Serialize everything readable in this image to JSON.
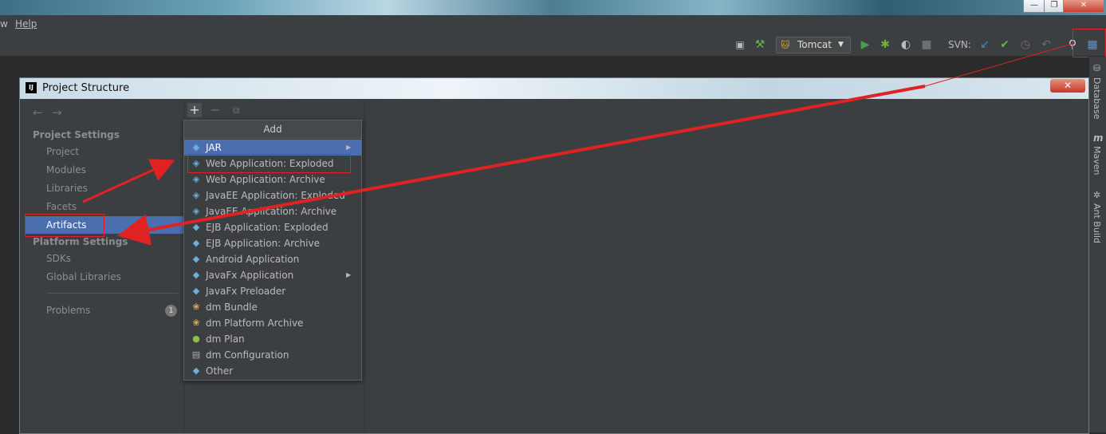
{
  "menubar": {
    "partial_item": "w",
    "help": "Help"
  },
  "toolbar": {
    "run_config": "Tomcat",
    "svn_label": "SVN:"
  },
  "right_strip": {
    "database": "Database",
    "maven": "Maven",
    "ant_build": "Ant Build"
  },
  "dialog": {
    "title": "Project Structure",
    "logo_text": "IJ",
    "close": "✕",
    "project_settings_header": "Project Settings",
    "project_items": [
      "Project",
      "Modules",
      "Libraries",
      "Facets",
      "Artifacts"
    ],
    "selected_item": "Artifacts",
    "platform_settings_header": "Platform Settings",
    "platform_items": [
      "SDKs",
      "Global Libraries"
    ],
    "problems": {
      "label": "Problems",
      "count": "1"
    }
  },
  "popup": {
    "title": "Add",
    "items": [
      {
        "label": "JAR",
        "icon": "diamond-icon",
        "submenu": true
      },
      {
        "label": "Web Application: Exploded",
        "icon": "web-artifact-icon"
      },
      {
        "label": "Web Application: Archive",
        "icon": "web-artifact-icon"
      },
      {
        "label": "JavaEE Application: Exploded",
        "icon": "javaee-artifact-icon"
      },
      {
        "label": "JavaEE Application: Archive",
        "icon": "javaee-artifact-icon"
      },
      {
        "label": "EJB Application: Exploded",
        "icon": "ejb-artifact-icon"
      },
      {
        "label": "EJB Application: Archive",
        "icon": "ejb-artifact-icon"
      },
      {
        "label": "Android Application",
        "icon": "diamond-icon"
      },
      {
        "label": "JavaFx Application",
        "icon": "diamond-icon",
        "submenu": true
      },
      {
        "label": "JavaFx Preloader",
        "icon": "diamond-icon"
      },
      {
        "label": "dm Bundle",
        "icon": "dm-bundle-icon"
      },
      {
        "label": "dm Platform Archive",
        "icon": "dm-bundle-icon"
      },
      {
        "label": "dm Plan",
        "icon": "dm-plan-icon"
      },
      {
        "label": "dm Configuration",
        "icon": "file-icon"
      },
      {
        "label": "Other",
        "icon": "diamond-icon"
      }
    ]
  },
  "colors": {
    "selection": "#4b6eaf",
    "annotation_red": "#e02222",
    "background": "#3c3f41"
  }
}
